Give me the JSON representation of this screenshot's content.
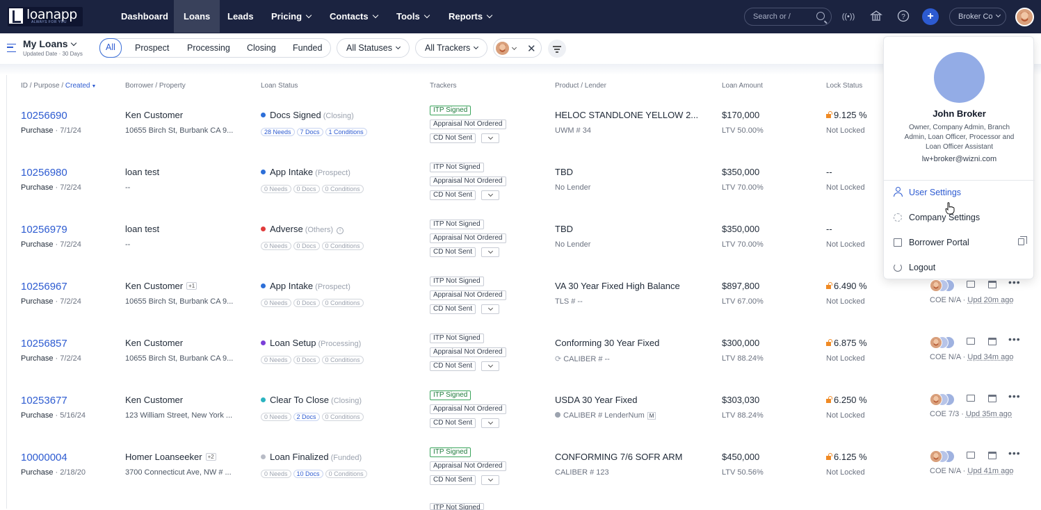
{
  "brand": {
    "logo_text": "loanapp",
    "tagline": "ALWAYS FOR YOU"
  },
  "nav": {
    "items": [
      {
        "label": "Dashboard"
      },
      {
        "label": "Loans",
        "active": true
      },
      {
        "label": "Leads"
      },
      {
        "label": "Pricing"
      },
      {
        "label": "Contacts"
      },
      {
        "label": "Tools"
      },
      {
        "label": "Reports"
      }
    ],
    "search_placeholder": "Search or /",
    "account_label": "Broker Co",
    "accent": "#2d5bd1"
  },
  "filters": {
    "view_title": "My Loans",
    "view_subtitle": "Updated Date · 30 Days",
    "tabs": [
      "All",
      "Prospect",
      "Processing",
      "Closing",
      "Funded"
    ],
    "active_tab": "All",
    "statuses": "All Statuses",
    "trackers": "All Trackers"
  },
  "columns": {
    "id": "ID / Purpose /",
    "created": "Created",
    "borrower": "Borrower / Property",
    "status": "Loan Status",
    "trackers": "Trackers",
    "product": "Product / Lender",
    "amount": "Loan Amount",
    "lock": "Lock Status"
  },
  "loans": [
    {
      "id": "10256690",
      "purpose": "Purchase",
      "date": "7/1/24",
      "borrower": "Ken Customer",
      "extra": "",
      "address": "10655 Birch St, Burbank CA 9...",
      "status": "Docs Signed",
      "stage": "(Closing)",
      "dot": "#2d6fd8",
      "info": false,
      "chips": [
        {
          "text": "28 Needs",
          "blue": true
        },
        {
          "text": "7 Docs",
          "blue": true
        },
        {
          "text": "1 Conditions",
          "blue": true
        }
      ],
      "itp": "ITP Signed",
      "itp_green": true,
      "appraisal": "Appraisal Not Ordered",
      "cd": "CD Not Sent",
      "product": "HELOC STANDLONE YELLOW 2...",
      "lender": "UWM # 34",
      "lender_icon": "",
      "mbadge": "",
      "amount": "$170,000",
      "ltv": "LTV 50.00%",
      "rate": "9.125 %",
      "lock_icon": true,
      "lock_status": "Not Locked",
      "coe": "",
      "updated": ""
    },
    {
      "id": "10256980",
      "purpose": "Purchase",
      "date": "7/2/24",
      "borrower": "loan test",
      "extra": "",
      "address": "--",
      "status": "App Intake",
      "stage": "(Prospect)",
      "dot": "#2d6fd8",
      "info": false,
      "chips": [
        {
          "text": "0 Needs",
          "blue": false
        },
        {
          "text": "0 Docs",
          "blue": false
        },
        {
          "text": "0 Conditions",
          "blue": false
        }
      ],
      "itp": "ITP Not Signed",
      "itp_green": false,
      "appraisal": "Appraisal Not Ordered",
      "cd": "CD Not Sent",
      "product": "TBD",
      "lender": "No Lender",
      "lender_icon": "",
      "mbadge": "",
      "amount": "$350,000",
      "ltv": "LTV 70.00%",
      "rate": "--",
      "lock_icon": false,
      "lock_status": "Not Locked",
      "coe": "",
      "updated": ""
    },
    {
      "id": "10256979",
      "purpose": "Purchase",
      "date": "7/2/24",
      "borrower": "loan test",
      "extra": "",
      "address": "--",
      "status": "Adverse",
      "stage": "(Others)",
      "dot": "#e03b3b",
      "info": true,
      "chips": [
        {
          "text": "0 Needs",
          "blue": false
        },
        {
          "text": "0 Docs",
          "blue": false
        },
        {
          "text": "0 Conditions",
          "blue": false
        }
      ],
      "itp": "ITP Not Signed",
      "itp_green": false,
      "appraisal": "Appraisal Not Ordered",
      "cd": "CD Not Sent",
      "product": "TBD",
      "lender": "No Lender",
      "lender_icon": "",
      "mbadge": "",
      "amount": "$350,000",
      "ltv": "LTV 70.00%",
      "rate": "--",
      "lock_icon": false,
      "lock_status": "Not Locked",
      "coe": "",
      "updated": ""
    },
    {
      "id": "10256967",
      "purpose": "Purchase",
      "date": "7/2/24",
      "borrower": "Ken Customer",
      "extra": "+1",
      "address": "10655 Birch St, Burbank CA 9...",
      "status": "App Intake",
      "stage": "(Prospect)",
      "dot": "#2d6fd8",
      "info": false,
      "chips": [
        {
          "text": "0 Needs",
          "blue": false
        },
        {
          "text": "0 Docs",
          "blue": false
        },
        {
          "text": "0 Conditions",
          "blue": false
        }
      ],
      "itp": "ITP Not Signed",
      "itp_green": false,
      "appraisal": "Appraisal Not Ordered",
      "cd": "CD Not Sent",
      "product": "VA 30 Year Fixed High Balance",
      "lender": "TLS # --",
      "lender_icon": "",
      "mbadge": "",
      "amount": "$897,800",
      "ltv": "LTV 67.00%",
      "rate": "6.490 %",
      "lock_icon": true,
      "lock_status": "Not Locked",
      "coe": "COE N/A",
      "updated": "Upd 20m ago"
    },
    {
      "id": "10256857",
      "purpose": "Purchase",
      "date": "7/2/24",
      "borrower": "Ken Customer",
      "extra": "",
      "address": "10655 Birch St, Burbank CA 9...",
      "status": "Loan Setup",
      "stage": "(Processing)",
      "dot": "#7b3fd8",
      "info": false,
      "chips": [
        {
          "text": "0 Needs",
          "blue": false
        },
        {
          "text": "0 Docs",
          "blue": false
        },
        {
          "text": "0 Conditions",
          "blue": false
        }
      ],
      "itp": "ITP Not Signed",
      "itp_green": false,
      "appraisal": "Appraisal Not Ordered",
      "cd": "CD Not Sent",
      "product": "Conforming 30 Year Fixed",
      "lender": "CALIBER # --",
      "lender_icon": "sync",
      "mbadge": "",
      "amount": "$300,000",
      "ltv": "LTV 88.24%",
      "rate": "6.875 %",
      "lock_icon": true,
      "lock_status": "Not Locked",
      "coe": "COE N/A",
      "updated": "Upd 34m ago"
    },
    {
      "id": "10253677",
      "purpose": "Purchase",
      "date": "5/16/24",
      "borrower": "Ken Customer",
      "extra": "",
      "address": "123 William Street, New York ...",
      "status": "Clear To Close",
      "stage": "(Closing)",
      "dot": "#2bb3c0",
      "info": false,
      "chips": [
        {
          "text": "0 Needs",
          "blue": false
        },
        {
          "text": "2 Docs",
          "blue": true
        },
        {
          "text": "0 Conditions",
          "blue": false
        }
      ],
      "itp": "ITP Signed",
      "itp_green": true,
      "appraisal": "Appraisal Not Ordered",
      "cd": "CD Not Sent",
      "product": "USDA 30 Year Fixed",
      "lender": "CALIBER # LenderNum",
      "lender_icon": "check",
      "mbadge": "M",
      "amount": "$303,030",
      "ltv": "LTV 88.24%",
      "rate": "6.250 %",
      "lock_icon": true,
      "lock_status": "Not Locked",
      "coe": "COE 7/3",
      "updated": "Upd 35m ago"
    },
    {
      "id": "10000004",
      "purpose": "Purchase",
      "date": "2/18/20",
      "borrower": "Homer Loanseeker",
      "extra": "+2",
      "address": "3700 Connecticut Ave, NW # ...",
      "status": "Loan Finalized",
      "stage": "(Funded)",
      "dot": "#b8bcc6",
      "info": false,
      "chips": [
        {
          "text": "0 Needs",
          "blue": false
        },
        {
          "text": "10 Docs",
          "blue": true
        },
        {
          "text": "0 Conditions",
          "blue": false
        }
      ],
      "itp": "ITP Signed",
      "itp_green": true,
      "appraisal": "Appraisal Not Ordered",
      "cd": "CD Not Sent",
      "product": "CONFORMING 7/6 SOFR ARM",
      "lender": "CALIBER # 123",
      "lender_icon": "",
      "mbadge": "",
      "amount": "$450,000",
      "ltv": "LTV 50.56%",
      "rate": "6.125 %",
      "lock_icon": true,
      "lock_status": "Not Locked",
      "coe": "COE N/A",
      "updated": "Upd 41m ago"
    }
  ],
  "next_row_tracker": "ITP Not Signed",
  "profile": {
    "name": "John Broker",
    "roles": "Owner, Company Admin, Branch Admin, Loan Officer, Processor and Loan Officer Assistant",
    "email": "lw+broker@wizni.com",
    "menu": [
      {
        "label": "User Settings",
        "icon": "user-icon"
      },
      {
        "label": "Company Settings",
        "icon": "gear-icon"
      },
      {
        "label": "Borrower Portal",
        "icon": "external-link-icon"
      },
      {
        "label": "Logout",
        "icon": "power-icon"
      }
    ]
  }
}
